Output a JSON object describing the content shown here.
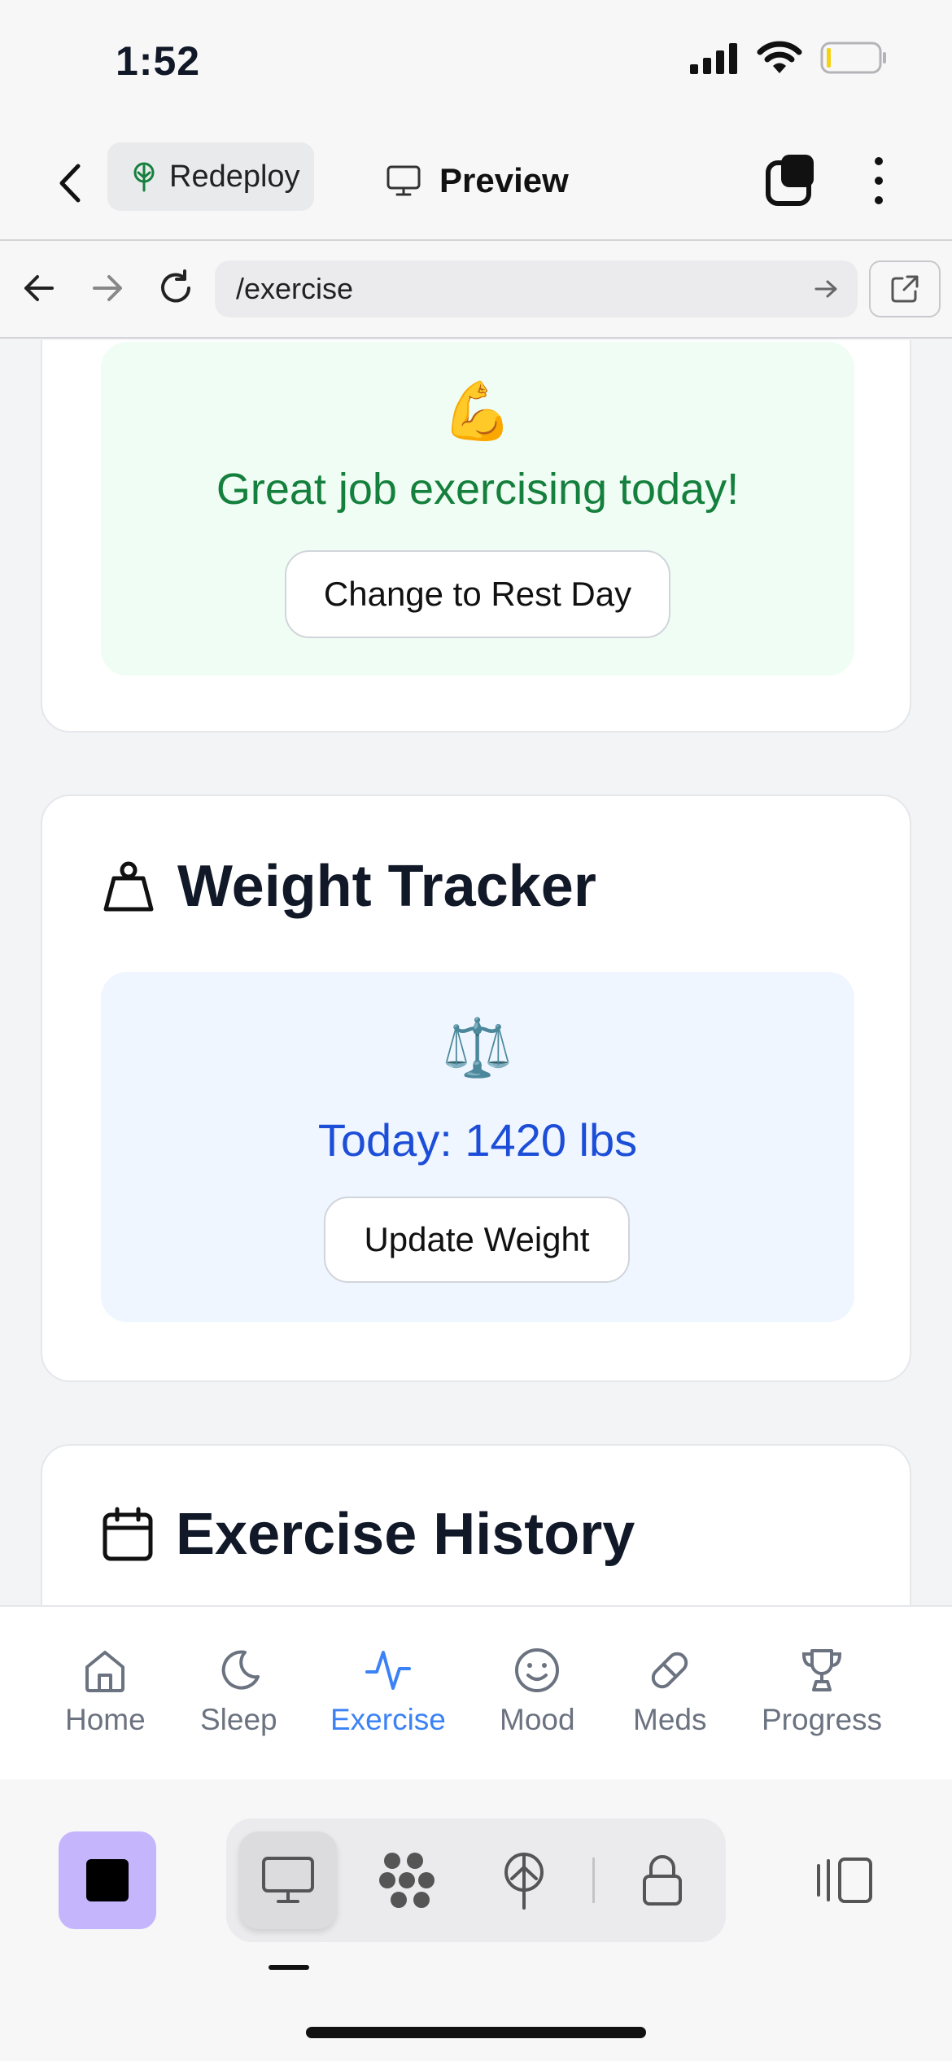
{
  "status_bar": {
    "time": "1:52"
  },
  "header": {
    "redeploy_label": "Redeploy",
    "preview_label": "Preview"
  },
  "browser": {
    "url": "/exercise"
  },
  "exercise_card": {
    "emoji": "💪",
    "message": "Great job exercising today!",
    "rest_button": "Change to Rest Day"
  },
  "weight_card": {
    "title": "Weight Tracker",
    "emoji": "⚖️",
    "today_text": "Today: 1420 lbs",
    "update_button": "Update Weight"
  },
  "history_card": {
    "title": "Exercise History"
  },
  "bottom_nav": {
    "items": [
      {
        "label": "Home",
        "icon": "home-icon"
      },
      {
        "label": "Sleep",
        "icon": "moon-icon"
      },
      {
        "label": "Exercise",
        "icon": "activity-icon",
        "active": true
      },
      {
        "label": "Mood",
        "icon": "smile-icon"
      },
      {
        "label": "Meds",
        "icon": "pill-icon"
      },
      {
        "label": "Progress",
        "icon": "trophy-icon"
      }
    ]
  },
  "colors": {
    "accent": "#3b82f6",
    "success": "#15803d",
    "weight_blue": "#1d4ed8",
    "stop_purple": "#c4b5fd"
  }
}
